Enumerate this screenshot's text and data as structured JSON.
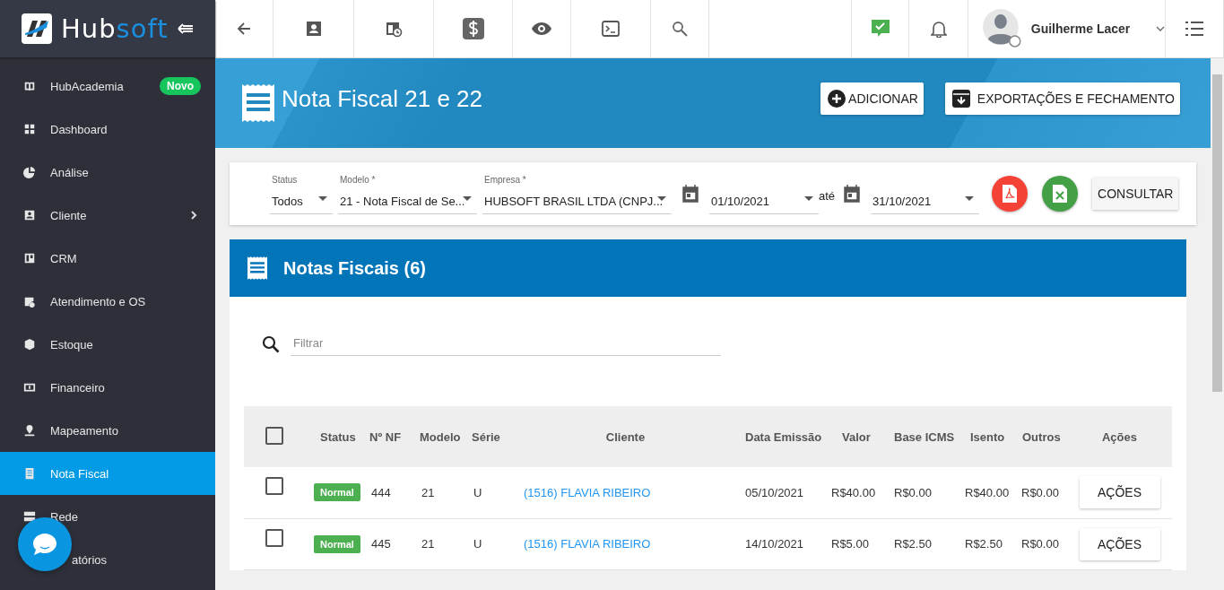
{
  "sidebar": {
    "brand": {
      "prefix": "Hub",
      "suffix": "soft"
    },
    "items": [
      {
        "label": "HubAcademia",
        "selected": false,
        "badge": "Novo",
        "expandable": false
      },
      {
        "label": "Dashboard",
        "selected": false,
        "expandable": false
      },
      {
        "label": "Análise",
        "selected": false,
        "expandable": false
      },
      {
        "label": "Cliente",
        "selected": false,
        "expandable": true
      },
      {
        "label": "CRM",
        "selected": false,
        "expandable": false
      },
      {
        "label": "Atendimento e OS",
        "selected": false,
        "expandable": false
      },
      {
        "label": "Estoque",
        "selected": false,
        "expandable": false
      },
      {
        "label": "Financeiro",
        "selected": false,
        "expandable": false
      },
      {
        "label": "Mapeamento",
        "selected": false,
        "expandable": false
      },
      {
        "label": "Nota Fiscal",
        "selected": true,
        "expandable": false
      },
      {
        "label": "Rede",
        "selected": false,
        "expandable": false
      },
      {
        "label": "atórios",
        "selected": false,
        "expandable": false,
        "covered": true
      }
    ]
  },
  "topbar": {
    "user": "Guilherme Lacer"
  },
  "page": {
    "title": "Nota Fiscal 21 e 22",
    "actions": [
      "ADICIONAR",
      "EXPORTAÇÕES E FECHAMENTO"
    ]
  },
  "filters": {
    "status": {
      "label": "Status",
      "value": "Todos"
    },
    "model": {
      "label": "Modelo *",
      "value": "21 - Nota Fiscal de Se..."
    },
    "company": {
      "label": "Empresa *",
      "value": "HUBSOFT BRASIL LTDA (CNPJ..."
    },
    "date_from": "01/10/2021",
    "separator": "até",
    "date_to": "31/10/2021",
    "submit": "CONSULTAR"
  },
  "table_card": {
    "title": "Notas Fiscais (6)",
    "search": {
      "placeholder": "Filtrar"
    },
    "select_all": {
      "checked": false
    },
    "columns": [
      "Status",
      "Nº NF",
      "Modelo",
      "Série",
      "Cliente",
      "Data Emissão",
      "Valor",
      "Base ICMS",
      "Isento",
      "Outros",
      "Ações"
    ],
    "rows": [
      {
        "checked": false,
        "status": "Normal",
        "number": "444",
        "model": "21",
        "series": "U",
        "client": "(1516) FLAVIA RIBEIRO",
        "date": "05/10/2021",
        "value": "R$40.00",
        "base_icms": "R$0.00",
        "exempt": "R$40.00",
        "others": "R$0.00",
        "action": "AÇÕES"
      },
      {
        "checked": false,
        "status": "Normal",
        "number": "445",
        "model": "21",
        "series": "U",
        "client": "(1516) FLAVIA RIBEIRO",
        "date": "14/10/2021",
        "value": "R$5.00",
        "base_icms": "R$2.50",
        "exempt": "R$2.50",
        "others": "R$0.00",
        "action": "AÇÕES"
      }
    ]
  }
}
